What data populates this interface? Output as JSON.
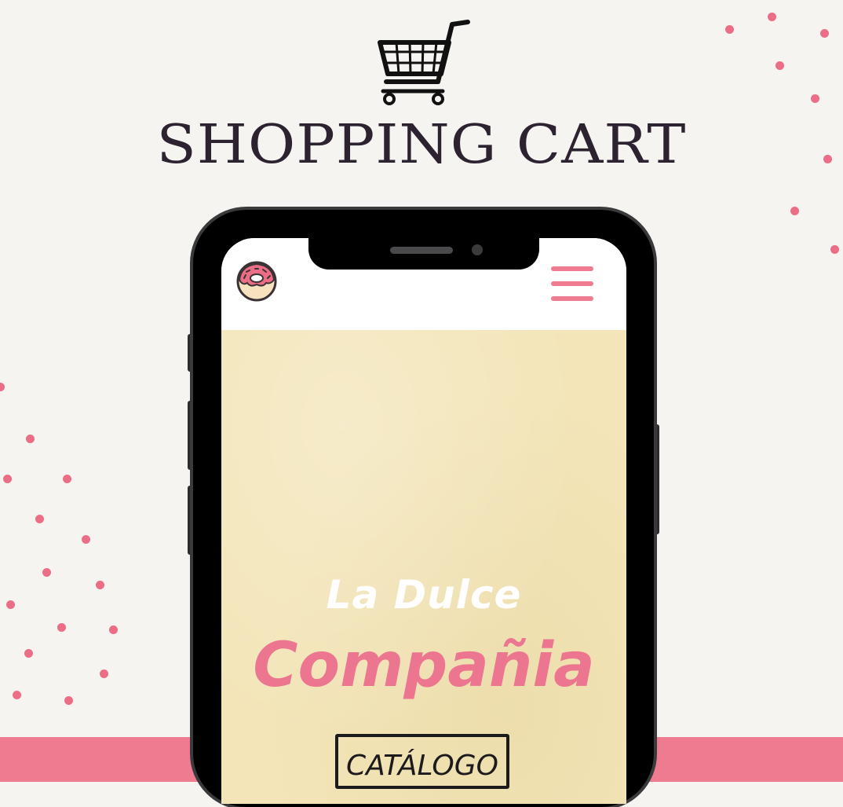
{
  "page": {
    "title": "SHOPPING CART"
  },
  "phone": {
    "hero": {
      "line1": "La Dulce",
      "line2": "Compañia",
      "catalog_label": "CATÁLOGO"
    }
  },
  "colors": {
    "background": "#f5f4f1",
    "accent_pink": "#ef7b91",
    "hero_background": "#f3e5b8",
    "title_text": "#2c2230"
  },
  "icons": {
    "cart": "shopping-cart-icon",
    "logo": "donut-logo-icon",
    "menu": "hamburger-menu-icon"
  }
}
